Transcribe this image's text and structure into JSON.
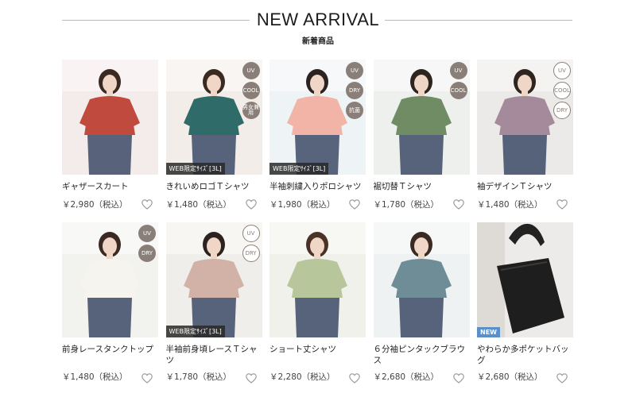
{
  "section": {
    "title": "NEW ARRIVAL",
    "subtitle": "新着商品"
  },
  "products": [
    {
      "name": "ギャザースカート",
      "price": "￥2,980（税込）",
      "badges": []
    },
    {
      "name": "きれいめロゴＴシャツ",
      "price": "￥1,480（税込）",
      "badges": [
        {
          "text": "UV",
          "style": "dark"
        },
        {
          "text": "COOL",
          "style": "dark"
        },
        {
          "text": "男女兼用",
          "style": "dark"
        }
      ],
      "tag": "WEB限定ｻｲｽﾞ[3L]"
    },
    {
      "name": "半袖刺繍入りポロシャツ",
      "price": "￥1,980（税込）",
      "badges": [
        {
          "text": "UV",
          "style": "dark"
        },
        {
          "text": "DRY",
          "style": "dark"
        },
        {
          "text": "抗菌",
          "style": "dark"
        }
      ],
      "tag": "WEB限定ｻｲｽﾞ[3L]"
    },
    {
      "name": "裾切替Ｔシャツ",
      "price": "￥1,780（税込）",
      "badges": [
        {
          "text": "UV",
          "style": "dark"
        },
        {
          "text": "COOL",
          "style": "dark"
        }
      ]
    },
    {
      "name": "袖デザインＴシャツ",
      "price": "￥1,480（税込）",
      "badges": [
        {
          "text": "UV",
          "style": "light"
        },
        {
          "text": "COOL",
          "style": "light"
        },
        {
          "text": "DRY",
          "style": "light"
        }
      ]
    },
    {
      "name": "前身レースタンクトップ",
      "price": "￥1,480（税込）",
      "badges": [
        {
          "text": "UV",
          "style": "dark"
        },
        {
          "text": "DRY",
          "style": "dark"
        }
      ]
    },
    {
      "name": "半袖前身頃レースＴシャツ",
      "price": "￥1,780（税込）",
      "badges": [
        {
          "text": "UV",
          "style": "light"
        },
        {
          "text": "DRY",
          "style": "light"
        }
      ],
      "tag": "WEB限定ｻｲｽﾞ[3L]"
    },
    {
      "name": "ショート丈シャツ",
      "price": "￥2,280（税込）",
      "badges": []
    },
    {
      "name": "６分袖ピンタックブラウス",
      "price": "￥2,680（税込）",
      "badges": []
    },
    {
      "name": "やわらか多ポケットバッグ",
      "price": "￥2,680（税込）",
      "badges": [],
      "new": "NEW"
    }
  ],
  "colors": {
    "heart": "#9a9a9a",
    "photos": [
      {
        "bg": "#f4ecea",
        "main": "#c04a3e",
        "skin": "#f0d6c6",
        "hair": "#3a2a22"
      },
      {
        "bg": "#f2ede8",
        "main": "#2f6b68",
        "skin": "#f0d6c6",
        "hair": "#3a2a22"
      },
      {
        "bg": "#eef3f6",
        "main": "#f2b4a6",
        "skin": "#f0d6c6",
        "hair": "#2c2320"
      },
      {
        "bg": "#eef0ee",
        "main": "#6f8c64",
        "skin": "#f0d6c6",
        "hair": "#2e2520"
      },
      {
        "bg": "#eceae8",
        "main": "#a58a9c",
        "skin": "#f0d6c6",
        "hair": "#2e2520"
      },
      {
        "bg": "#f2f2ee",
        "main": "#f6f4ee",
        "skin": "#f0d6c6",
        "hair": "#3a2a22"
      },
      {
        "bg": "#f0eeea",
        "main": "#d2b2a6",
        "skin": "#f0d6c6",
        "hair": "#2c2320"
      },
      {
        "bg": "#f1f1ec",
        "main": "#b8c69c",
        "skin": "#f0d6c6",
        "hair": "#4a3326"
      },
      {
        "bg": "#eef2f2",
        "main": "#6f8d96",
        "skin": "#f0d6c6",
        "hair": "#3a2a22"
      },
      {
        "bg": "#ecebe9",
        "main": "#1e1e1e",
        "skin": "#ecebe9",
        "hair": "#ecebe9"
      }
    ]
  }
}
